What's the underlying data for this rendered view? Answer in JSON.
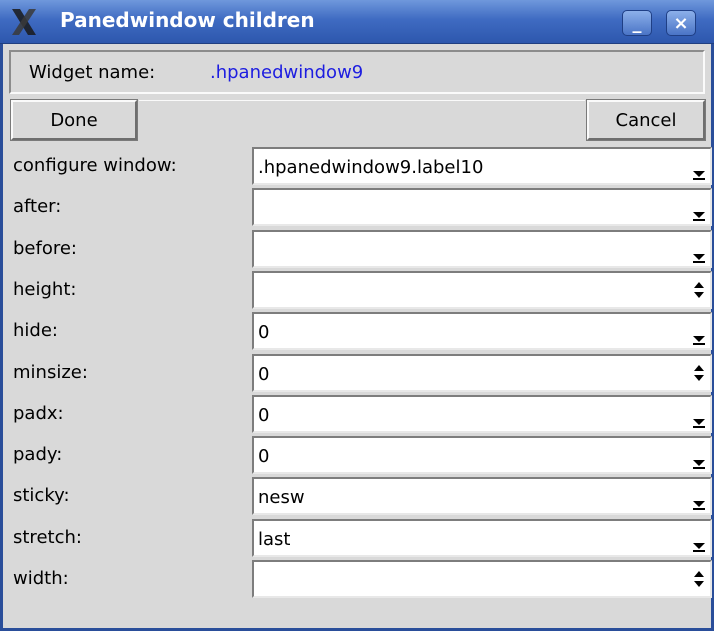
{
  "window": {
    "title": "Panedwindow children",
    "icon": "x-icon",
    "minimize_symbol": "_",
    "close_symbol": "×"
  },
  "widget": {
    "label": "Widget name:",
    "value": ".hpanedwindow9",
    "value_color": "#1d1de0"
  },
  "buttons": {
    "done": "Done",
    "cancel": "Cancel"
  },
  "options": [
    {
      "label": "configure window:",
      "value": ".hpanedwindow9.label10",
      "control": "dropdown"
    },
    {
      "label": "after:",
      "value": "",
      "control": "dropdown"
    },
    {
      "label": "before:",
      "value": "",
      "control": "dropdown"
    },
    {
      "label": "height:",
      "value": "",
      "control": "spinbox"
    },
    {
      "label": "hide:",
      "value": "0",
      "control": "dropdown"
    },
    {
      "label": "minsize:",
      "value": "0",
      "control": "spinbox"
    },
    {
      "label": "padx:",
      "value": "0",
      "control": "dropdown"
    },
    {
      "label": "pady:",
      "value": "0",
      "control": "dropdown"
    },
    {
      "label": "sticky:",
      "value": "nesw",
      "control": "dropdown"
    },
    {
      "label": "stretch:",
      "value": "last",
      "control": "dropdown"
    },
    {
      "label": "width:",
      "value": "",
      "control": "spinbox"
    }
  ],
  "colors": {
    "titlebar": "#3f6bc2",
    "background": "#d9d9d9",
    "field_background": "#ffffff"
  }
}
